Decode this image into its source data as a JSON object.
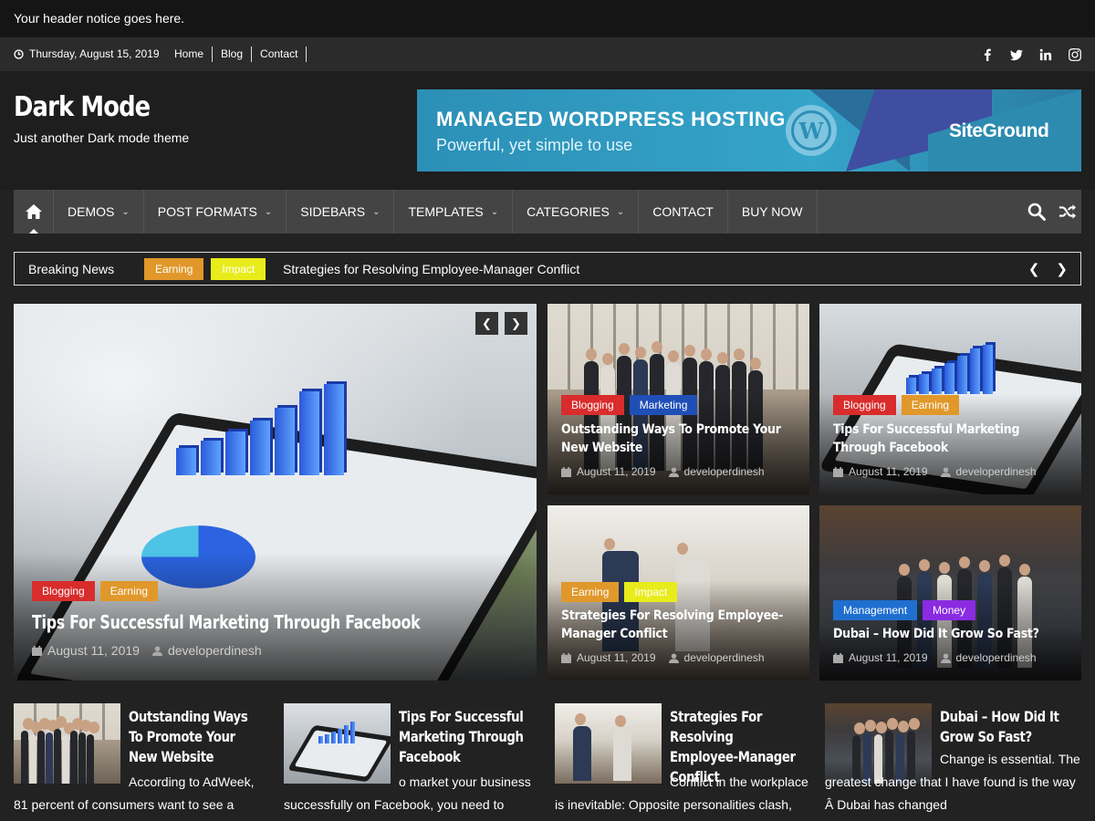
{
  "notice": "Your header notice goes here.",
  "topbar": {
    "date": "Thursday, August 15, 2019",
    "links": [
      "Home",
      "Blog",
      "Contact"
    ],
    "social": [
      "facebook-icon",
      "twitter-icon",
      "linkedin-icon",
      "instagram-icon"
    ]
  },
  "site": {
    "title": "Dark Mode",
    "description": "Just another Dark mode theme"
  },
  "ad": {
    "headline": "MANAGED WORDPRESS HOSTING",
    "subline": "Powerful, yet simple to use",
    "brand": "SiteGround"
  },
  "nav": {
    "items": [
      {
        "label": "DEMOS",
        "dropdown": true
      },
      {
        "label": "POST FORMATS",
        "dropdown": true
      },
      {
        "label": "SIDEBARS",
        "dropdown": true
      },
      {
        "label": "TEMPLATES",
        "dropdown": true
      },
      {
        "label": "CATEGORIES",
        "dropdown": true
      },
      {
        "label": "CONTACT",
        "dropdown": false
      },
      {
        "label": "BUY NOW",
        "dropdown": false
      }
    ]
  },
  "ticker": {
    "label": "Breaking News",
    "tags": [
      "Earning",
      "Impact"
    ],
    "headline": "Strategies for Resolving Employee-Manager Conflict"
  },
  "featured": {
    "main": {
      "tags": [
        "Blogging",
        "Earning"
      ],
      "title": "Tips For Successful Marketing Through Facebook",
      "date": "August 11, 2019",
      "author": "developerdinesh"
    },
    "grid": [
      {
        "tags": [
          "Blogging",
          "Marketing"
        ],
        "title": "Outstanding Ways To Promote Your New Website",
        "date": "August 11, 2019",
        "author": "developerdinesh"
      },
      {
        "tags": [
          "Blogging",
          "Earning"
        ],
        "title": "Tips For Successful Marketing Through Facebook",
        "date": "August 11, 2019",
        "author": "developerdinesh"
      },
      {
        "tags": [
          "Earning",
          "Impact"
        ],
        "title": "Strategies For Resolving Employee-Manager Conflict",
        "date": "August 11, 2019",
        "author": "developerdinesh"
      },
      {
        "tags": [
          "Management",
          "Money"
        ],
        "title": "Dubai – How Did It Grow So Fast?",
        "date": "August 11, 2019",
        "author": "developerdinesh"
      }
    ]
  },
  "posts": [
    {
      "title": "Outstanding Ways To Promote Your New Website",
      "excerpt": "According to AdWeek, 81 percent of consumers want to see a"
    },
    {
      "title": "Tips For Successful Marketing Through Facebook",
      "excerpt": "o market your business successfully on Facebook, you need to"
    },
    {
      "title": "Strategies For Resolving Employee-Manager Conflict",
      "excerpt": "Conflict in the workplace is inevitable: Opposite personalities clash,"
    },
    {
      "title": "Dubai – How Did It Grow So Fast?",
      "excerpt": "Change is essential. The greatest change that I have found is the way Â Dubai has changed"
    }
  ]
}
